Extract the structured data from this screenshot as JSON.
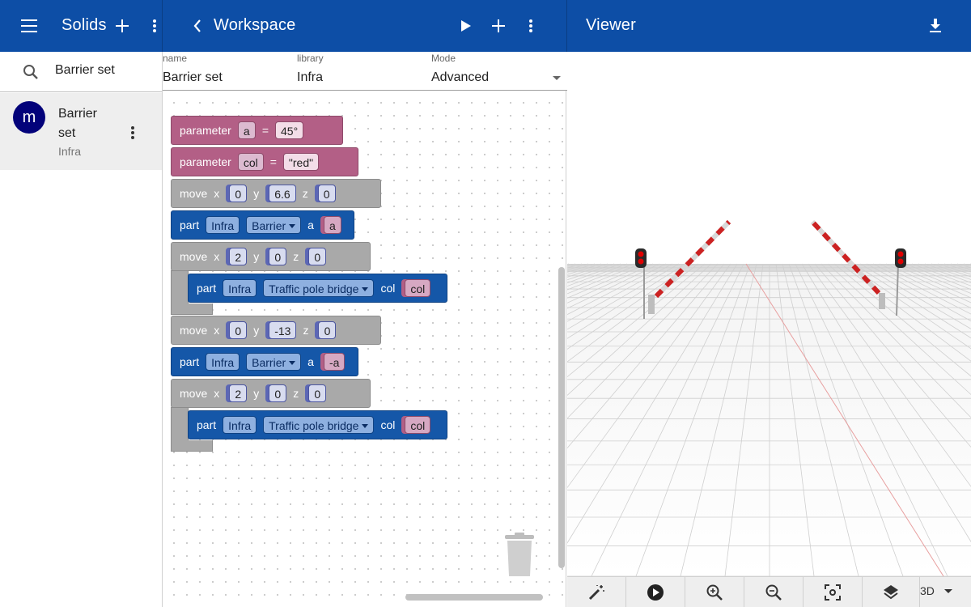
{
  "left_header": {
    "title": "Solids"
  },
  "search": {
    "value": "Barrier set"
  },
  "solids_list": [
    {
      "avatar_letter": "m",
      "title": "Barrier set",
      "subtitle": "Infra"
    }
  ],
  "workspace_header": {
    "title": "Workspace"
  },
  "form": {
    "name_label": "name",
    "name_value": "Barrier set",
    "library_label": "library",
    "library_value": "Infra",
    "mode_label": "Mode",
    "mode_value": "Advanced"
  },
  "blocks": {
    "param1": {
      "keyword": "parameter",
      "name": "a",
      "eq": "=",
      "value": "45°"
    },
    "param2": {
      "keyword": "parameter",
      "name": "col",
      "eq": "=",
      "value": "\"red\""
    },
    "move1": {
      "keyword": "move",
      "x_label": "x",
      "x": "0",
      "y_label": "y",
      "y": "6.6",
      "z_label": "z",
      "z": "0"
    },
    "part1": {
      "keyword": "part",
      "library": "Infra",
      "solid": "Barrier",
      "arg_label": "a",
      "arg": "a"
    },
    "move2": {
      "keyword": "move",
      "x_label": "x",
      "x": "2",
      "y_label": "y",
      "y": "0",
      "z_label": "z",
      "z": "0"
    },
    "part2": {
      "keyword": "part",
      "library": "Infra",
      "solid": "Traffic pole bridge",
      "arg_label": "col",
      "arg": "col"
    },
    "move3": {
      "keyword": "move",
      "x_label": "x",
      "x": "0",
      "y_label": "y",
      "y": "-13",
      "z_label": "z",
      "z": "0"
    },
    "part3": {
      "keyword": "part",
      "library": "Infra",
      "solid": "Barrier",
      "arg_label": "a",
      "arg": "-a"
    },
    "move4": {
      "keyword": "move",
      "x_label": "x",
      "x": "2",
      "y_label": "y",
      "y": "0",
      "z_label": "z",
      "z": "0"
    },
    "part4": {
      "keyword": "part",
      "library": "Infra",
      "solid": "Traffic pole bridge",
      "arg_label": "col",
      "arg": "col"
    }
  },
  "viewer_header": {
    "title": "Viewer"
  },
  "viewer_toolbar": {
    "view_mode": "3D"
  },
  "colors": {
    "appbar": "#0d4ea6",
    "avatar": "#03027a",
    "parameter_block": "#b35f86",
    "move_block": "#a9a9a9",
    "part_block": "#1557a8"
  },
  "icons": [
    "menu-icon",
    "add-icon",
    "more-vert-icon",
    "chevron-left-icon",
    "play-icon",
    "download-icon",
    "search-icon",
    "trash-icon",
    "magic-wand-icon",
    "play-circle-icon",
    "zoom-in-icon",
    "zoom-out-icon",
    "center-focus-icon",
    "layers-icon"
  ]
}
